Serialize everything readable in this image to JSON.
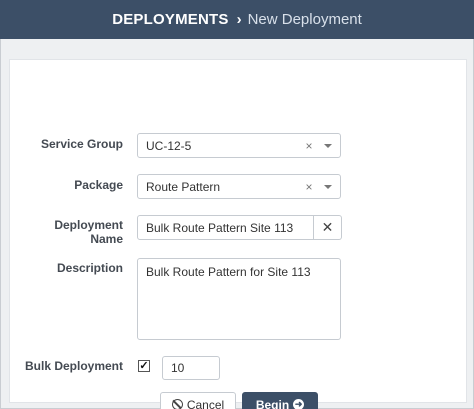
{
  "header": {
    "section": "DEPLOYMENTS",
    "separator": "›",
    "page": "New Deployment"
  },
  "form": {
    "service_group": {
      "label": "Service Group",
      "value": "UC-12-5",
      "clear": "×"
    },
    "package": {
      "label": "Package",
      "value": "Route Pattern",
      "clear": "×"
    },
    "deployment_name": {
      "label_line1": "Deployment",
      "label_line2": "Name",
      "value": "Bulk Route Pattern Site 113",
      "clear": "✕"
    },
    "description": {
      "label": "Description",
      "value": "Bulk Route Pattern for Site 113"
    },
    "bulk_deployment": {
      "label": "Bulk Deployment",
      "checked": true,
      "check_mark": "✓",
      "count": "10"
    }
  },
  "actions": {
    "cancel_label": "Cancel",
    "begin_label": "Begin"
  },
  "colors": {
    "header_bg": "#3c4f67",
    "primary_button": "#3c4f67"
  }
}
